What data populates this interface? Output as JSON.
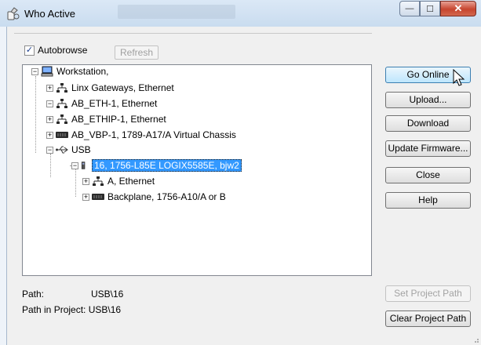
{
  "window": {
    "title": "Who Active",
    "minimize_glyph": "—",
    "maximize_glyph": "☐",
    "close_glyph": "✕"
  },
  "toolbar": {
    "autobrowse_label": "Autobrowse",
    "autobrowse_checked": true,
    "check_glyph": "✓",
    "refresh_label": "Refresh"
  },
  "tree": {
    "collapse_glyph": "−",
    "expand_glyph": "+",
    "items": [
      {
        "label": "Workstation,",
        "icon": "computer-icon"
      },
      {
        "label": "Linx Gateways, Ethernet",
        "icon": "network-icon"
      },
      {
        "label": "AB_ETH-1, Ethernet",
        "icon": "network-icon"
      },
      {
        "label": "AB_ETHIP-1, Ethernet",
        "icon": "network-icon"
      },
      {
        "label": "AB_VBP-1, 1789-A17/A Virtual Chassis",
        "icon": "backplane-icon"
      },
      {
        "label": "USB",
        "icon": "usb-icon"
      },
      {
        "label": "16, 1756-L85E LOGIX5585E, bjw2",
        "icon": "controller-icon",
        "selected": true
      },
      {
        "label": "A, Ethernet",
        "icon": "network-icon"
      },
      {
        "label": "Backplane, 1756-A10/A or B",
        "icon": "backplane-icon"
      }
    ]
  },
  "buttons": {
    "go_online": "Go Online",
    "upload": "Upload...",
    "download": "Download",
    "update_firmware": "Update Firmware...",
    "close": "Close",
    "help": "Help",
    "set_project_path": "Set Project Path",
    "clear_project_path": "Clear Project Path"
  },
  "path": {
    "path_label": "Path:",
    "path_value": "USB\\16",
    "project_label": "Path in Project:",
    "project_value": "USB\\16"
  },
  "colors": {
    "selection": "#3399ff",
    "title_gradient_top": "#dbe8f6",
    "close_button": "#c7452f"
  }
}
